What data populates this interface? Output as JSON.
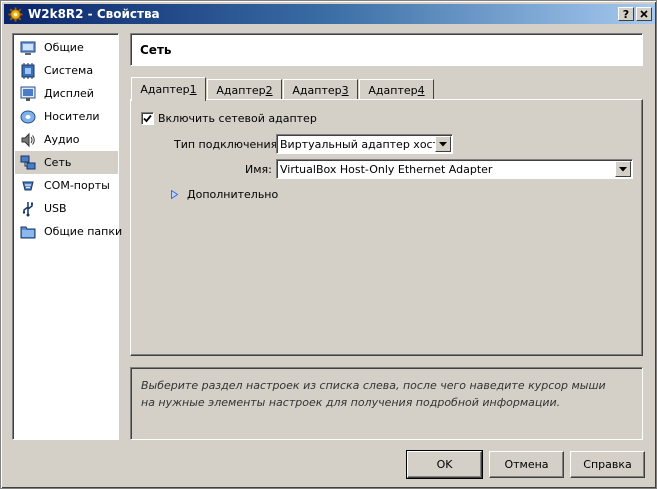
{
  "window": {
    "title": "W2k8R2 - Свойства",
    "help_btn": "?",
    "close_btn": "X"
  },
  "sidebar": {
    "items": [
      {
        "label": "Общие",
        "icon": "general-icon"
      },
      {
        "label": "Система",
        "icon": "system-icon"
      },
      {
        "label": "Дисплей",
        "icon": "display-icon"
      },
      {
        "label": "Носители",
        "icon": "storage-icon"
      },
      {
        "label": "Аудио",
        "icon": "audio-icon"
      },
      {
        "label": "Сеть",
        "icon": "network-icon",
        "selected": true
      },
      {
        "label": "COM-порты",
        "icon": "serial-ports-icon"
      },
      {
        "label": "USB",
        "icon": "usb-icon"
      },
      {
        "label": "Общие папки",
        "icon": "shared-folders-icon"
      }
    ]
  },
  "header": {
    "title": "Сеть"
  },
  "tabs": [
    {
      "label": "Адаптер ",
      "num": "1",
      "active": true
    },
    {
      "label": "Адаптер ",
      "num": "2"
    },
    {
      "label": "Адаптер ",
      "num": "3"
    },
    {
      "label": "Адаптер ",
      "num": "4"
    }
  ],
  "adapter": {
    "enable_label": "Включить сетевой адаптер",
    "enabled": true,
    "attach_label": "Тип подключения:",
    "attach_value": "Виртуальный адаптер хоста",
    "name_label": "Имя:",
    "name_value": "VirtualBox Host-Only Ethernet Adapter",
    "advanced_label": "Дополнительно"
  },
  "info": {
    "text": "Выберите раздел настроек из списка слева, после чего наведите курсор мыши на нужные элементы настроек для получения подробной информации."
  },
  "buttons": {
    "ok": "OK",
    "cancel": "Отмена",
    "help": "Справка"
  },
  "colors": {
    "title_start": "#0a246a",
    "title_end": "#a6caf0",
    "face": "#d4d0c8",
    "link_arrow": "#3a6fd8"
  }
}
